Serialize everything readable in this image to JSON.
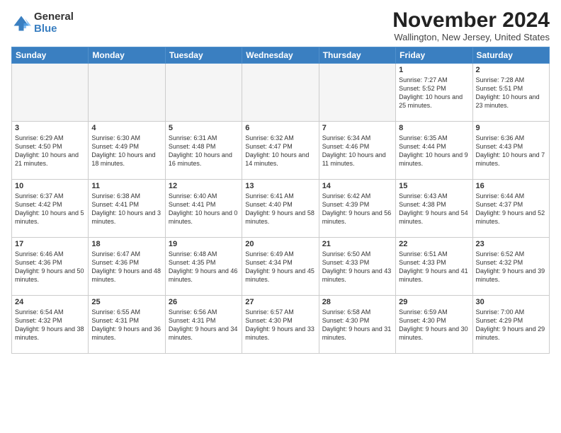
{
  "header": {
    "logo_general": "General",
    "logo_blue": "Blue",
    "month_title": "November 2024",
    "location": "Wallington, New Jersey, United States"
  },
  "weekdays": [
    "Sunday",
    "Monday",
    "Tuesday",
    "Wednesday",
    "Thursday",
    "Friday",
    "Saturday"
  ],
  "weeks": [
    [
      {
        "day": "",
        "empty": true
      },
      {
        "day": "",
        "empty": true
      },
      {
        "day": "",
        "empty": true
      },
      {
        "day": "",
        "empty": true
      },
      {
        "day": "",
        "empty": true
      },
      {
        "day": "1",
        "sunrise": "Sunrise: 7:27 AM",
        "sunset": "Sunset: 5:52 PM",
        "daylight": "Daylight: 10 hours and 25 minutes."
      },
      {
        "day": "2",
        "sunrise": "Sunrise: 7:28 AM",
        "sunset": "Sunset: 5:51 PM",
        "daylight": "Daylight: 10 hours and 23 minutes."
      }
    ],
    [
      {
        "day": "3",
        "sunrise": "Sunrise: 6:29 AM",
        "sunset": "Sunset: 4:50 PM",
        "daylight": "Daylight: 10 hours and 21 minutes."
      },
      {
        "day": "4",
        "sunrise": "Sunrise: 6:30 AM",
        "sunset": "Sunset: 4:49 PM",
        "daylight": "Daylight: 10 hours and 18 minutes."
      },
      {
        "day": "5",
        "sunrise": "Sunrise: 6:31 AM",
        "sunset": "Sunset: 4:48 PM",
        "daylight": "Daylight: 10 hours and 16 minutes."
      },
      {
        "day": "6",
        "sunrise": "Sunrise: 6:32 AM",
        "sunset": "Sunset: 4:47 PM",
        "daylight": "Daylight: 10 hours and 14 minutes."
      },
      {
        "day": "7",
        "sunrise": "Sunrise: 6:34 AM",
        "sunset": "Sunset: 4:46 PM",
        "daylight": "Daylight: 10 hours and 11 minutes."
      },
      {
        "day": "8",
        "sunrise": "Sunrise: 6:35 AM",
        "sunset": "Sunset: 4:44 PM",
        "daylight": "Daylight: 10 hours and 9 minutes."
      },
      {
        "day": "9",
        "sunrise": "Sunrise: 6:36 AM",
        "sunset": "Sunset: 4:43 PM",
        "daylight": "Daylight: 10 hours and 7 minutes."
      }
    ],
    [
      {
        "day": "10",
        "sunrise": "Sunrise: 6:37 AM",
        "sunset": "Sunset: 4:42 PM",
        "daylight": "Daylight: 10 hours and 5 minutes."
      },
      {
        "day": "11",
        "sunrise": "Sunrise: 6:38 AM",
        "sunset": "Sunset: 4:41 PM",
        "daylight": "Daylight: 10 hours and 3 minutes."
      },
      {
        "day": "12",
        "sunrise": "Sunrise: 6:40 AM",
        "sunset": "Sunset: 4:41 PM",
        "daylight": "Daylight: 10 hours and 0 minutes."
      },
      {
        "day": "13",
        "sunrise": "Sunrise: 6:41 AM",
        "sunset": "Sunset: 4:40 PM",
        "daylight": "Daylight: 9 hours and 58 minutes."
      },
      {
        "day": "14",
        "sunrise": "Sunrise: 6:42 AM",
        "sunset": "Sunset: 4:39 PM",
        "daylight": "Daylight: 9 hours and 56 minutes."
      },
      {
        "day": "15",
        "sunrise": "Sunrise: 6:43 AM",
        "sunset": "Sunset: 4:38 PM",
        "daylight": "Daylight: 9 hours and 54 minutes."
      },
      {
        "day": "16",
        "sunrise": "Sunrise: 6:44 AM",
        "sunset": "Sunset: 4:37 PM",
        "daylight": "Daylight: 9 hours and 52 minutes."
      }
    ],
    [
      {
        "day": "17",
        "sunrise": "Sunrise: 6:46 AM",
        "sunset": "Sunset: 4:36 PM",
        "daylight": "Daylight: 9 hours and 50 minutes."
      },
      {
        "day": "18",
        "sunrise": "Sunrise: 6:47 AM",
        "sunset": "Sunset: 4:36 PM",
        "daylight": "Daylight: 9 hours and 48 minutes."
      },
      {
        "day": "19",
        "sunrise": "Sunrise: 6:48 AM",
        "sunset": "Sunset: 4:35 PM",
        "daylight": "Daylight: 9 hours and 46 minutes."
      },
      {
        "day": "20",
        "sunrise": "Sunrise: 6:49 AM",
        "sunset": "Sunset: 4:34 PM",
        "daylight": "Daylight: 9 hours and 45 minutes."
      },
      {
        "day": "21",
        "sunrise": "Sunrise: 6:50 AM",
        "sunset": "Sunset: 4:33 PM",
        "daylight": "Daylight: 9 hours and 43 minutes."
      },
      {
        "day": "22",
        "sunrise": "Sunrise: 6:51 AM",
        "sunset": "Sunset: 4:33 PM",
        "daylight": "Daylight: 9 hours and 41 minutes."
      },
      {
        "day": "23",
        "sunrise": "Sunrise: 6:52 AM",
        "sunset": "Sunset: 4:32 PM",
        "daylight": "Daylight: 9 hours and 39 minutes."
      }
    ],
    [
      {
        "day": "24",
        "sunrise": "Sunrise: 6:54 AM",
        "sunset": "Sunset: 4:32 PM",
        "daylight": "Daylight: 9 hours and 38 minutes."
      },
      {
        "day": "25",
        "sunrise": "Sunrise: 6:55 AM",
        "sunset": "Sunset: 4:31 PM",
        "daylight": "Daylight: 9 hours and 36 minutes."
      },
      {
        "day": "26",
        "sunrise": "Sunrise: 6:56 AM",
        "sunset": "Sunset: 4:31 PM",
        "daylight": "Daylight: 9 hours and 34 minutes."
      },
      {
        "day": "27",
        "sunrise": "Sunrise: 6:57 AM",
        "sunset": "Sunset: 4:30 PM",
        "daylight": "Daylight: 9 hours and 33 minutes."
      },
      {
        "day": "28",
        "sunrise": "Sunrise: 6:58 AM",
        "sunset": "Sunset: 4:30 PM",
        "daylight": "Daylight: 9 hours and 31 minutes."
      },
      {
        "day": "29",
        "sunrise": "Sunrise: 6:59 AM",
        "sunset": "Sunset: 4:30 PM",
        "daylight": "Daylight: 9 hours and 30 minutes."
      },
      {
        "day": "30",
        "sunrise": "Sunrise: 7:00 AM",
        "sunset": "Sunset: 4:29 PM",
        "daylight": "Daylight: 9 hours and 29 minutes."
      }
    ]
  ]
}
